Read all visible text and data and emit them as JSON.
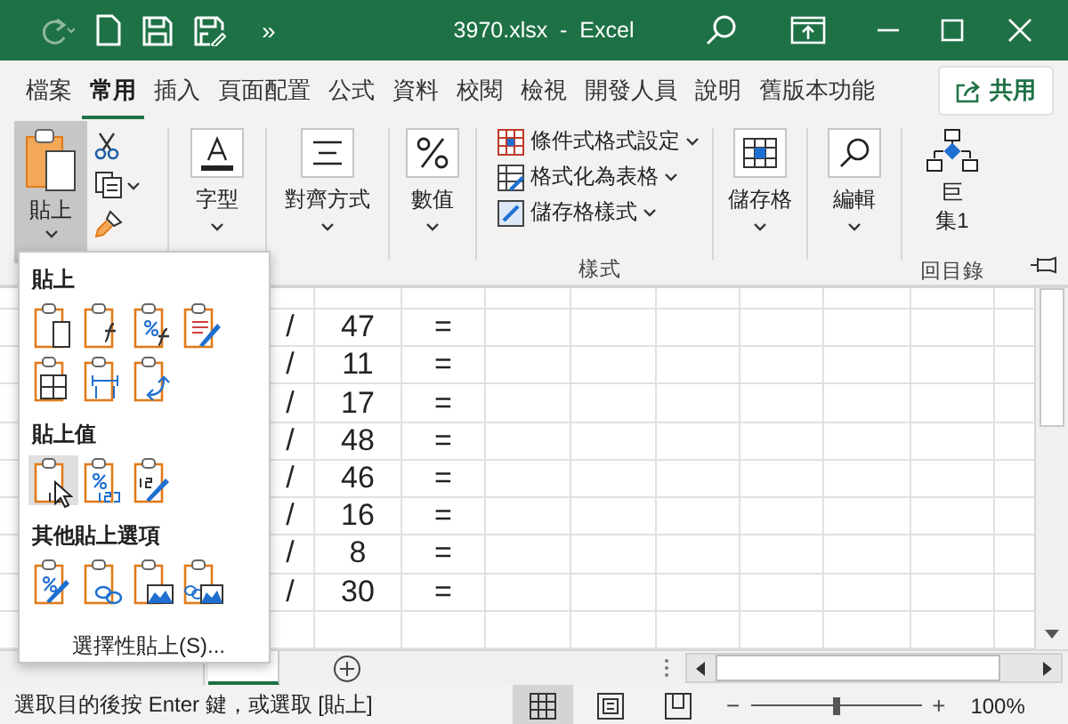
{
  "window": {
    "title": "3970.xlsx  -  Excel",
    "overflow": "»"
  },
  "ribbon_tabs": [
    {
      "label": "檔案",
      "selected": false
    },
    {
      "label": "常用",
      "selected": true
    },
    {
      "label": "插入",
      "selected": false
    },
    {
      "label": "頁面配置",
      "selected": false
    },
    {
      "label": "公式",
      "selected": false
    },
    {
      "label": "資料",
      "selected": false
    },
    {
      "label": "校閱",
      "selected": false
    },
    {
      "label": "檢視",
      "selected": false
    },
    {
      "label": "開發人員",
      "selected": false
    },
    {
      "label": "說明",
      "selected": false
    },
    {
      "label": "舊版本功能",
      "selected": false
    }
  ],
  "share_button": "共用",
  "ribbon": {
    "paste": {
      "label": "貼上",
      "pressed": true
    },
    "font": "字型",
    "alignment": "對齊方式",
    "number": "數值",
    "styles_items": [
      "條件式格式設定",
      "格式化為表格",
      "儲存格樣式"
    ],
    "styles_label": "樣式",
    "cells": "儲存格",
    "editing": "編輯",
    "macro": "巨集1",
    "macro_group_label": "回目錄"
  },
  "sheet": {
    "rows": [
      {
        "column_1": "/",
        "column_2": "47",
        "column_3": "="
      },
      {
        "column_1": "/",
        "column_2": "11",
        "column_3": "="
      },
      {
        "column_1": "/",
        "column_2": "17",
        "column_3": "="
      },
      {
        "column_1": "/",
        "column_2": "48",
        "column_3": "="
      },
      {
        "column_1": "/",
        "column_2": "46",
        "column_3": "="
      },
      {
        "column_1": "/",
        "column_2": "16",
        "column_3": "="
      },
      {
        "column_1": "/",
        "column_2": "8",
        "column_3": "="
      },
      {
        "column_1": "/",
        "column_2": "30",
        "column_3": "="
      }
    ]
  },
  "paste_menu": {
    "sections": [
      {
        "heading": "貼上",
        "options": [
          {
            "kind": "keep",
            "selected": false
          },
          {
            "kind": "formulas",
            "selected": false
          },
          {
            "kind": "formulas_number",
            "selected": false
          },
          {
            "kind": "keep_source",
            "selected": false
          },
          {
            "kind": "no_borders",
            "selected": false
          },
          {
            "kind": "keep_widths",
            "selected": false
          },
          {
            "kind": "transpose",
            "selected": false
          }
        ]
      },
      {
        "heading": "貼上值",
        "options": [
          {
            "kind": "values",
            "selected": true
          },
          {
            "kind": "values_number",
            "selected": false
          },
          {
            "kind": "values_source",
            "selected": false
          }
        ]
      },
      {
        "heading": "其他貼上選項",
        "options": [
          {
            "kind": "formatting",
            "selected": false
          },
          {
            "kind": "link",
            "selected": false
          },
          {
            "kind": "picture",
            "selected": false
          },
          {
            "kind": "linked_picture",
            "selected": false
          }
        ]
      }
    ],
    "footer": "選擇性貼上(S)..."
  },
  "status": {
    "message": "選取目的後按 Enter 鍵，或選取 [貼上]",
    "views": [
      {
        "kind": "normal",
        "selected": true
      },
      {
        "kind": "page_layout",
        "selected": false
      },
      {
        "kind": "page_break",
        "selected": false
      }
    ],
    "zoom_minus": "−",
    "zoom_plus": "+",
    "zoom": {
      "level": 0.5,
      "reading": "100%"
    }
  }
}
